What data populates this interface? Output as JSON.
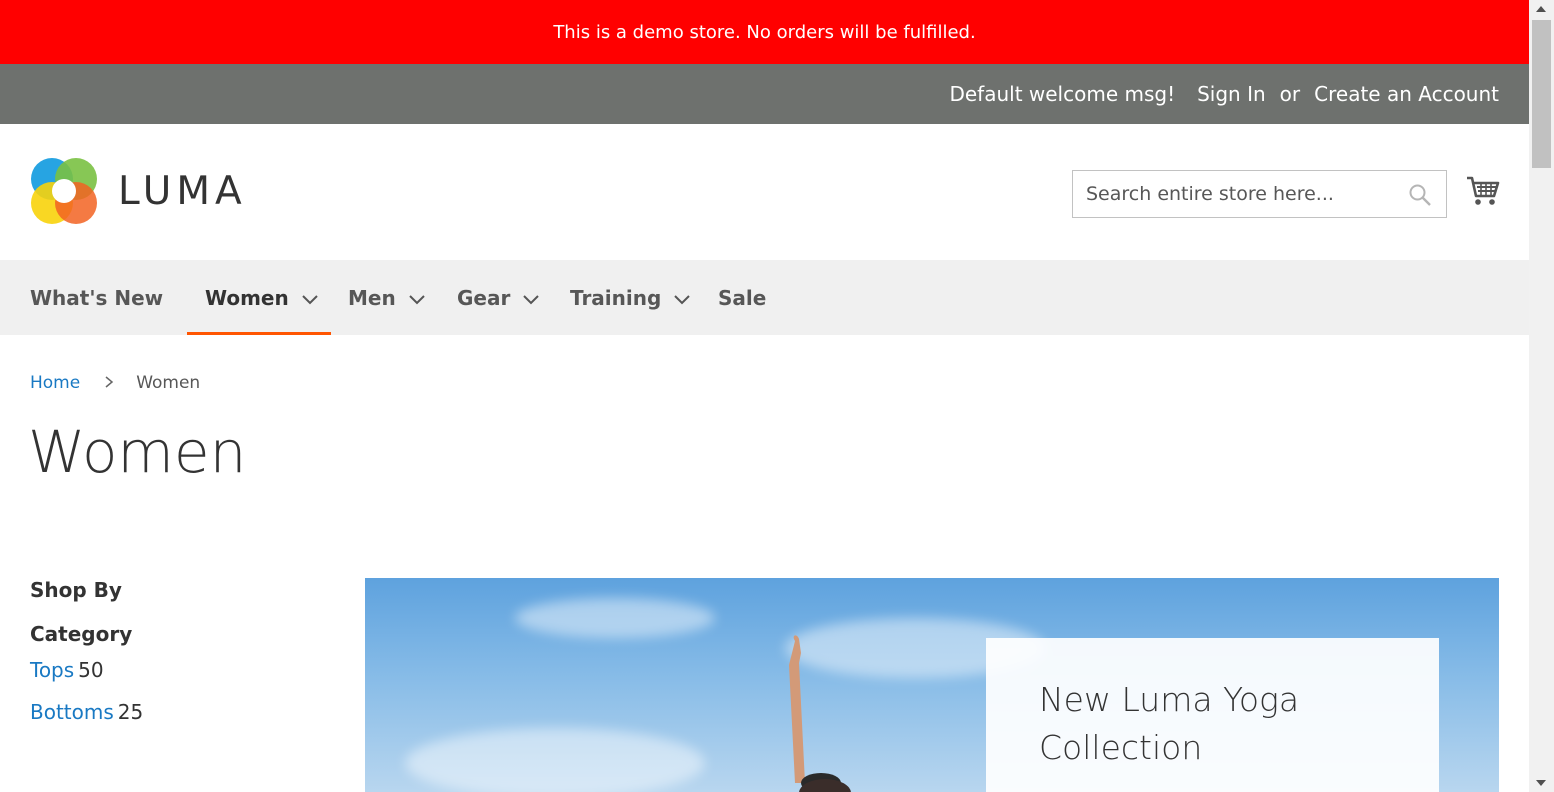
{
  "demo_notice": "This is a demo store. No orders will be fulfilled.",
  "panel": {
    "welcome": "Default welcome msg!",
    "sign_in": "Sign In",
    "or": "or",
    "create_account": "Create an Account"
  },
  "logo": {
    "text": "LUMA"
  },
  "search": {
    "placeholder": "Search entire store here..."
  },
  "nav": {
    "items": [
      {
        "label": "What's New",
        "has_dropdown": false
      },
      {
        "label": "Women",
        "has_dropdown": true,
        "active": true
      },
      {
        "label": "Men",
        "has_dropdown": true
      },
      {
        "label": "Gear",
        "has_dropdown": true
      },
      {
        "label": "Training",
        "has_dropdown": true
      },
      {
        "label": "Sale",
        "has_dropdown": false
      }
    ]
  },
  "breadcrumbs": {
    "home": "Home",
    "current": "Women"
  },
  "page_title": "Women",
  "sidebar": {
    "shop_by": "Shop By",
    "category_title": "Category",
    "filters": [
      {
        "label": "Tops",
        "count": "50"
      },
      {
        "label": "Bottoms",
        "count": "25"
      }
    ]
  },
  "hero": {
    "title": "New Luma Yoga Collection"
  },
  "colors": {
    "demo_banner": "#ff0000",
    "header_panel": "#6e716e",
    "nav_bg": "#f0f0f0",
    "active_underline": "#ff5501",
    "link": "#1979c3"
  },
  "icons": [
    "luma-logo-icon",
    "search-icon",
    "cart-icon",
    "chevron-down-icon",
    "breadcrumb-chevron-icon"
  ]
}
